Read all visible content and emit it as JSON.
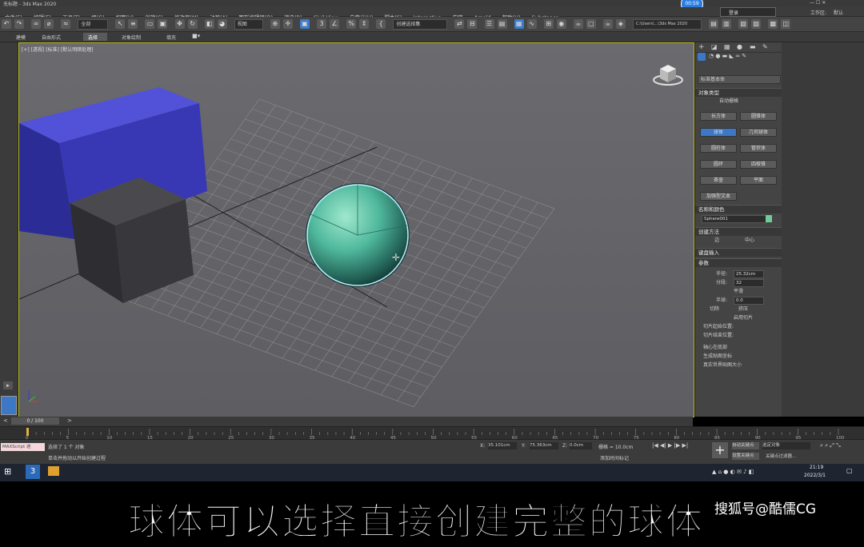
{
  "window": {
    "title": "无标题 - 3ds Max 2020",
    "clock_badge": "00:59",
    "user": "登录",
    "workspace_label": "工作区:",
    "workspace_value": "默认"
  },
  "menu": [
    "文件(F)",
    "编辑(E)",
    "工具(T)",
    "组(G)",
    "视图(V)",
    "创建(C)",
    "修改器(M)",
    "动画(A)",
    "图形编辑器(D)",
    "渲染(R)",
    "Civil View",
    "自定义(U)",
    "脚本(S)",
    "Interactive",
    "内容",
    "Arnold",
    "帮助(H)",
    "Substance"
  ],
  "toolbar": {
    "filter": "全部",
    "viewcoord": "视图",
    "selection_set": "创建选择集",
    "path": "C:\\Users\\...\\3ds Max 2020"
  },
  "tabs": [
    "建模",
    "自由形式",
    "选择",
    "对象绘制",
    "填充"
  ],
  "viewport": {
    "label": "[+] [透视] [标准] [默认明暗处理]"
  },
  "cmd": {
    "category": "标准基本体",
    "rollout_type": "对象类型",
    "autogrid": "自动栅格",
    "objects": [
      "长方体",
      "圆锥体",
      "球体",
      "几何球体",
      "圆柱体",
      "管状体",
      "圆环",
      "四棱锥",
      "茶壶",
      "平面",
      "加强型文本"
    ],
    "selected_object": "球体",
    "rollout_name": "名称和颜色",
    "name": "Sphere001",
    "rollout_method": "创建方法",
    "method_edge": "边",
    "method_center": "中心",
    "rollout_keyboard": "键盘输入",
    "rollout_params": "参数",
    "radius_label": "半径:",
    "radius_value": "25.32cm",
    "segments_label": "分段:",
    "segments_value": "32",
    "smooth": "平滑",
    "hemisphere_label": "半球:",
    "hemisphere_value": "0.0",
    "chop": "切除",
    "squash": "挤压",
    "slice": "启用切片",
    "slice_from": "切片起始位置:",
    "slice_to": "切片结束位置:",
    "base_pivot": "轴心在底部",
    "gen_map": "生成贴图坐标",
    "real_world": "真实世界贴图大小"
  },
  "timeline": {
    "frame": "0 / 100",
    "ticks": [
      "0",
      "5",
      "10",
      "15",
      "20",
      "25",
      "30",
      "35",
      "40",
      "45",
      "50",
      "55",
      "60",
      "65",
      "70",
      "75",
      "80",
      "85",
      "90",
      "95",
      "100"
    ]
  },
  "status": {
    "maxscript": "MAXScript 迷",
    "selected": "选择了 1 个 对象",
    "hint": "单击并拖动以开始创建过程",
    "x_label": "X:",
    "x_value": "35.101cm",
    "y_label": "Y:",
    "y_value": "75.363cm",
    "z_label": "Z:",
    "z_value": "0.0cm",
    "grid": "栅格 = 10.0cm",
    "addtime": "添加时间标记",
    "autokey": "自动关键点",
    "selobj": "选定对象",
    "setkey": "设置关键点",
    "keyfilter": "关键点过滤器..."
  },
  "taskbar": {
    "time": "21:19",
    "date": "2022/3/1"
  },
  "caption": {
    "text": "球体可以选择直接创建完整的球体",
    "watermark": "搜狐号@酷儒CG"
  },
  "colors": {
    "sphere": "#4fb89c",
    "box_blue": "#3a3ab8",
    "box_dark": "#3a3a3e",
    "selection_blue": "#3c78c6",
    "viewport_border": "#b5b52a"
  }
}
